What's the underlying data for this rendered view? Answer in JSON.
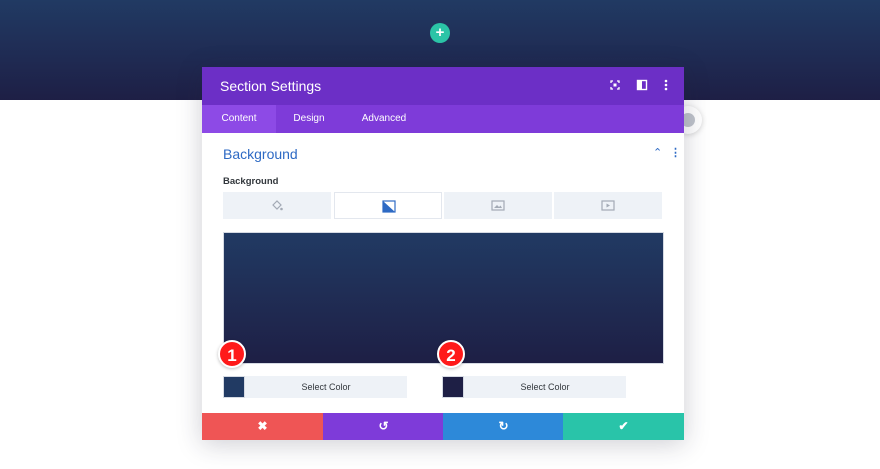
{
  "hero": {
    "add_glyph": "+"
  },
  "modal": {
    "title": "Section Settings",
    "header_icons": [
      "fullscreen-icon",
      "split-view-icon",
      "more-options-icon"
    ],
    "tabs": [
      {
        "label": "Content",
        "active": true
      },
      {
        "label": "Design",
        "active": false
      },
      {
        "label": "Advanced",
        "active": false
      }
    ],
    "section_title": "Background",
    "field_label": "Background",
    "bg_types": [
      "color-icon",
      "gradient-icon",
      "image-icon",
      "video-icon"
    ],
    "active_bg_type": "gradient",
    "gradient": {
      "start_color": "#213a63",
      "end_color": "#1e1f45"
    },
    "stops": [
      {
        "badge": "1",
        "color": "#213a63",
        "button": "Select Color"
      },
      {
        "badge": "2",
        "color": "#1e1f45",
        "button": "Select Color"
      }
    ],
    "footer": {
      "cancel": "✖",
      "undo": "↺",
      "redo": "↻",
      "save": "✔",
      "colors": {
        "cancel": "#ef5555",
        "undo": "#7e3bd9",
        "redo": "#2d89d9",
        "save": "#29c4a9"
      }
    }
  }
}
